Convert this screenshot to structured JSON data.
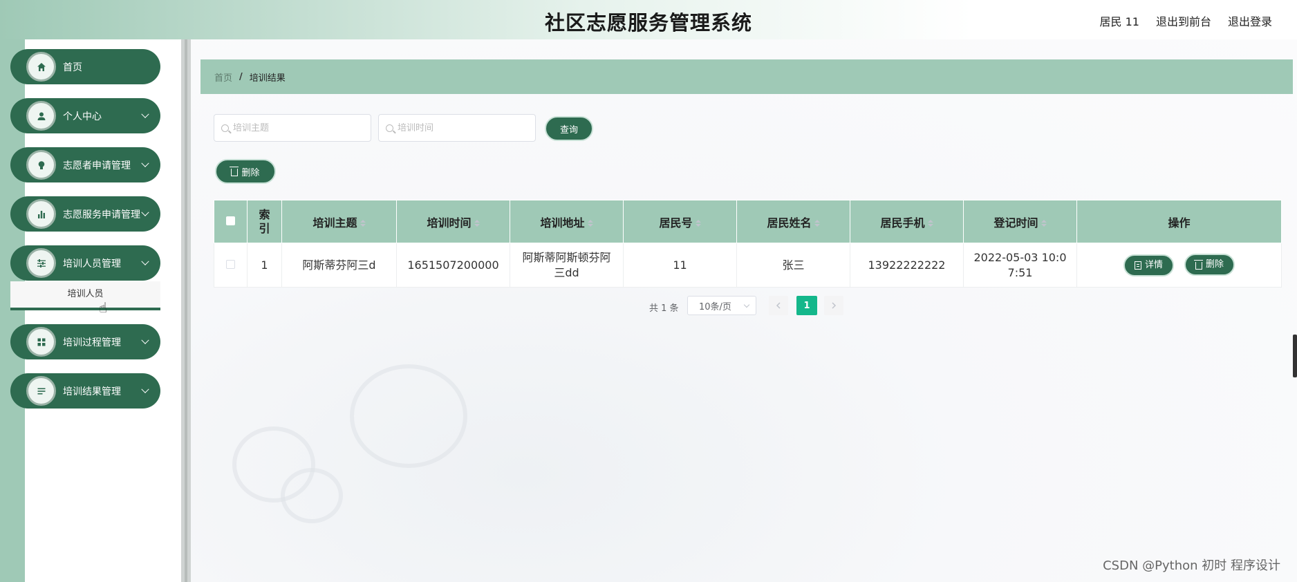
{
  "header": {
    "title": "社区志愿服务管理系统",
    "user": "居民 11",
    "front_link": "退出到前台",
    "logout_link": "退出登录"
  },
  "sidebar": {
    "items": [
      {
        "label": "首页",
        "icon": "home-icon"
      },
      {
        "label": "个人中心",
        "icon": "user-icon"
      },
      {
        "label": "志愿者申请管理",
        "icon": "bulb-icon"
      },
      {
        "label": "志愿服务申请管理",
        "icon": "bar-chart-icon"
      },
      {
        "label": "培训人员管理",
        "icon": "sliders-icon"
      },
      {
        "label": "培训过程管理",
        "icon": "grid-icon"
      },
      {
        "label": "培训结果管理",
        "icon": "list-icon"
      }
    ],
    "submenu_label": "培训人员"
  },
  "breadcrumb": {
    "home": "首页",
    "separator": "/",
    "current": "培训结果"
  },
  "search": {
    "topic_placeholder": "培训主题",
    "time_placeholder": "培训时间",
    "query_label": "查询"
  },
  "toolbar": {
    "delete_label": "删除"
  },
  "table": {
    "headers": [
      "索引",
      "培训主题",
      "培训时间",
      "培训地址",
      "居民号",
      "居民姓名",
      "居民手机",
      "登记时间",
      "操作"
    ],
    "rows": [
      {
        "index": "1",
        "topic": "阿斯蒂芬阿三d",
        "time": "1651507200000",
        "address": "阿斯蒂阿斯顿芬阿三dd",
        "resident_no": "11",
        "name": "张三",
        "phone": "13922222222",
        "register_time": "2022-05-03 10:07:51",
        "detail_label": "详情",
        "delete_label": "删除"
      }
    ]
  },
  "pagination": {
    "total": "共 1 条",
    "page_size": "10条/页",
    "current_page": "1"
  },
  "watermark": "CSDN @Python 初时 程序设计",
  "colors": {
    "primary": "#2e6b50",
    "accent": "#9fc9b6",
    "page_active": "#14b78b"
  }
}
